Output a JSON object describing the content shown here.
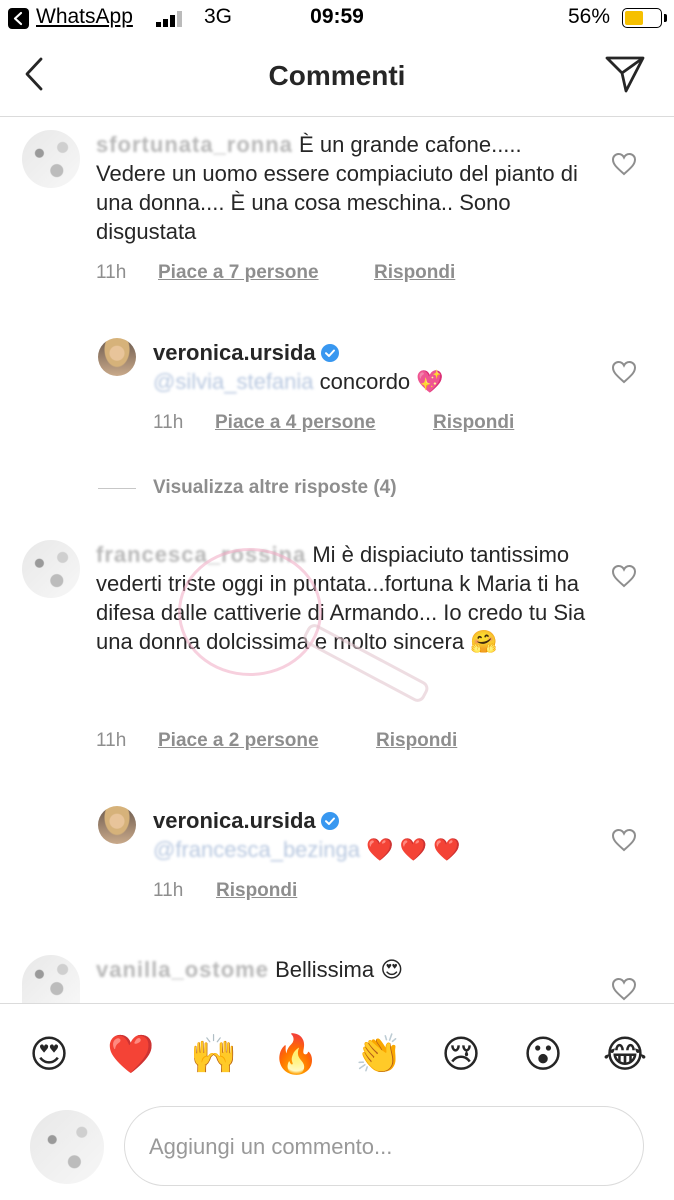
{
  "status_bar": {
    "back_app": "WhatsApp",
    "network": "3G",
    "time": "09:59",
    "battery": "56%",
    "battery_level": 0.56,
    "battery_color": "#f6c000"
  },
  "header": {
    "title": "Commenti",
    "back_icon": "chevron-left-icon",
    "send_icon": "paper-plane-icon"
  },
  "comments": [
    {
      "username_blurred": "sfortunata_ronna",
      "text": "È un grande cafone..... Vedere un uomo essere compiaciuto del pianto di una donna.... È una cosa meschina.. Sono disgustata",
      "time": "11h",
      "likes": "Piace a 7 persone",
      "reply": "Rispondi"
    },
    {
      "username": "veronica.ursida",
      "mention_blurred": "@silvia_stefania",
      "text": "concordo 💖",
      "time": "11h",
      "likes": "Piace a 4 persone",
      "reply": "Rispondi"
    },
    {
      "view_more": "Visualizza altre risposte (4)"
    },
    {
      "username_blurred": "francesca_rossina",
      "text": "Mi è dispiaciuto tantissimo vederti triste oggi in puntata...fortuna k Maria ti ha difesa dalle cattiverie di Armando... Io credo tu Sia una donna dolcissima e molto sincera 🤗",
      "time": "11h",
      "likes": "Piace a 2 persone",
      "reply": "Rispondi"
    },
    {
      "username": "veronica.ursida",
      "mention_blurred": "@francesca_bezinga",
      "text": "❤️ ❤️ ❤️",
      "time": "11h",
      "reply": "Rispondi"
    },
    {
      "username_blurred": "vanilla_ostome",
      "text": "Bellissima 😍"
    }
  ],
  "emoji_bar": [
    "😍",
    "❤️",
    "🙌",
    "🔥",
    "👏",
    "😢",
    "😮",
    "😂"
  ],
  "composer": {
    "placeholder": "Aggiungi un commento..."
  },
  "colors": {
    "text": "#262626",
    "meta": "#8e8e8e",
    "verified": "#3897f0",
    "divider": "#dbdbdb"
  }
}
